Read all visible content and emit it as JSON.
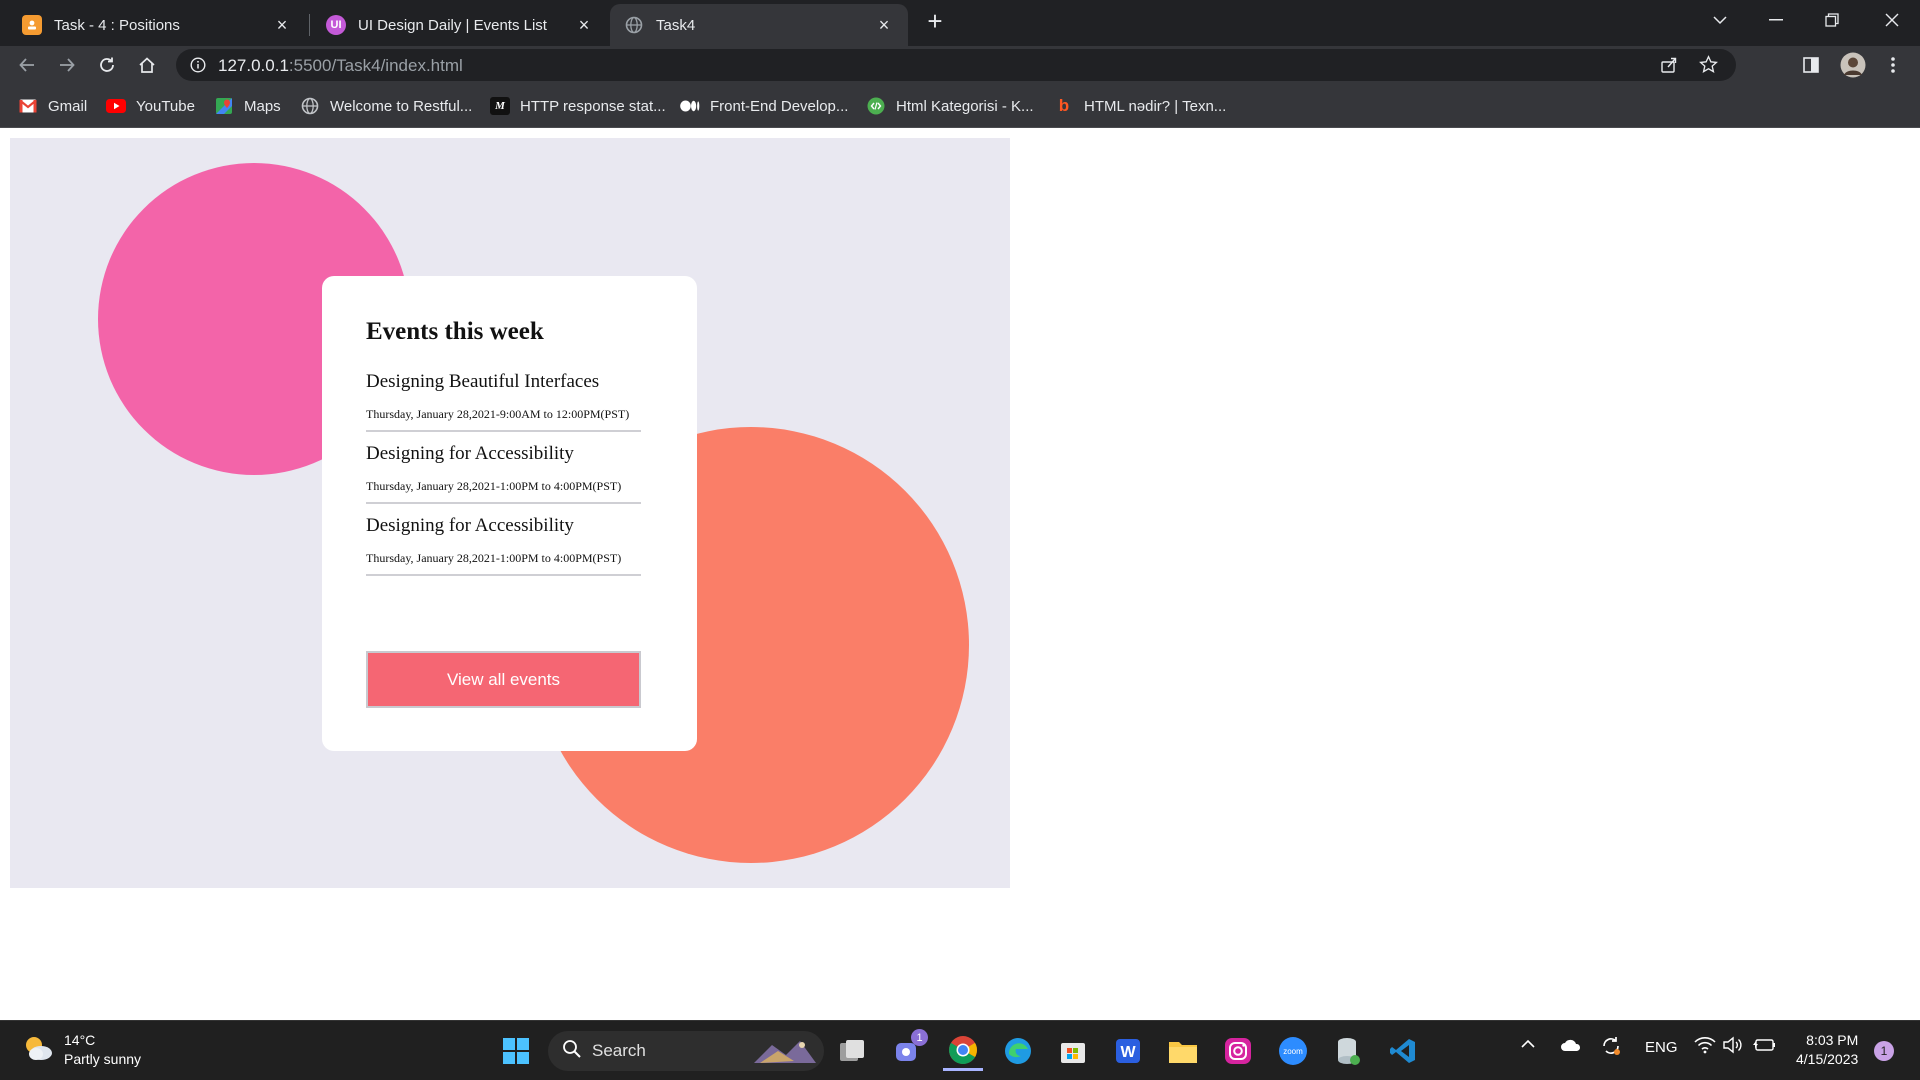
{
  "browser": {
    "tabs": [
      {
        "title": "Task - 4 : Positions",
        "icon": "slides-icon",
        "color": "#f59b31"
      },
      {
        "title": "UI Design Daily | Events List",
        "icon": "ui-icon",
        "color": "#c45ad8"
      },
      {
        "title": "Task4",
        "icon": "globe-icon",
        "color": "#9aa0a6"
      }
    ],
    "url_host": "127.0.0.1",
    "url_rest": ":5500/Task4/index.html",
    "bookmarks": [
      "Gmail",
      "YouTube",
      "Maps",
      "Welcome to Restful...",
      "HTTP response stat...",
      "Front-End Develop...",
      "Html Kategorisi - K...",
      "HTML nədir? | Texn..."
    ]
  },
  "page": {
    "title": "Events this week",
    "events": [
      {
        "name": "Designing Beautiful Interfaces",
        "date": "Thursday, January 28,2021-9:00AM to 12:00PM(PST)"
      },
      {
        "name": "Designing for Accessibility",
        "date": "Thursday, January 28,2021-1:00PM to 4:00PM(PST)"
      },
      {
        "name": "Designing for Accessibility",
        "date": "Thursday, January 28,2021-1:00PM to 4:00PM(PST)"
      }
    ],
    "button_label": "View all events",
    "colors": {
      "background": "#e9e8f1",
      "pink_circle": "#f364a9",
      "coral_circle": "#fa7e68",
      "button": "#f56673"
    }
  },
  "taskbar": {
    "weather_temp": "14°C",
    "weather_desc": "Partly sunny",
    "search_label": "Search",
    "teams_badge": "1",
    "language": "ENG",
    "time": "8:03 PM",
    "date": "4/15/2023",
    "notification_count": "1"
  }
}
